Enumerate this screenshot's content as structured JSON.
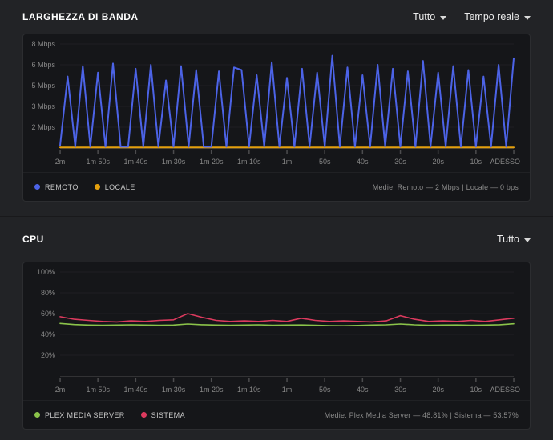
{
  "controls": {
    "bandwidth_filter": "Tutto",
    "bandwidth_range": "Tempo reale",
    "cpu_filter": "Tutto"
  },
  "chart_data": [
    {
      "type": "line",
      "title": "LARGHEZZA DI BANDA",
      "averages": "Medie: Remoto — 2 Mbps | Locale — 0 bps",
      "ylim": [
        0,
        8
      ],
      "y_ticks": [
        {
          "value": 1.6,
          "label": "2 Mbps"
        },
        {
          "value": 3.2,
          "label": "3 Mbps"
        },
        {
          "value": 4.8,
          "label": "5 Mbps"
        },
        {
          "value": 6.4,
          "label": "6 Mbps"
        },
        {
          "value": 8,
          "label": "8 Mbps"
        }
      ],
      "x_tick_labels": [
        "2m",
        "1m 50s",
        "1m 40s",
        "1m 30s",
        "1m 20s",
        "1m 10s",
        "1m",
        "50s",
        "40s",
        "30s",
        "20s",
        "10s",
        "ADESSO"
      ],
      "legend_position": "bottom-left",
      "grid": "faint-horizontal",
      "series": [
        {
          "name": "LOCALE",
          "color": "#e5a00d",
          "values": [
            0.05,
            0.05
          ]
        },
        {
          "name": "REMOTO",
          "color": "#4c63e7",
          "values": [
            0.2,
            5.5,
            0.1,
            6.3,
            0.1,
            5.8,
            0.1,
            6.5,
            0.1,
            0.1,
            6.1,
            0.1,
            6.4,
            0.1,
            5.2,
            0.1,
            6.3,
            0.1,
            6.0,
            0.1,
            0.1,
            5.9,
            0.1,
            6.2,
            6.0,
            0.1,
            5.6,
            0.1,
            6.6,
            0.1,
            5.4,
            0.1,
            6.1,
            0.1,
            5.8,
            0.1,
            7.1,
            0.1,
            6.2,
            0.1,
            5.6,
            0.1,
            6.4,
            0.1,
            6.1,
            0.1,
            5.9,
            0.1,
            6.7,
            0.1,
            5.8,
            0.1,
            6.3,
            0.1,
            6.0,
            0.1,
            5.5,
            0.1,
            6.4,
            0.1,
            6.9
          ]
        }
      ]
    },
    {
      "type": "line",
      "title": "CPU",
      "averages": "Medie: Plex Media Server — 48.81% | Sistema — 53.57%",
      "ylim": [
        0,
        100
      ],
      "y_ticks": [
        {
          "value": 20,
          "label": "20%"
        },
        {
          "value": 40,
          "label": "40%"
        },
        {
          "value": 60,
          "label": "60%"
        },
        {
          "value": 80,
          "label": "80%"
        },
        {
          "value": 100,
          "label": "100%"
        }
      ],
      "x_tick_labels": [
        "2m",
        "1m 50s",
        "1m 40s",
        "1m 30s",
        "1m 20s",
        "1m 10s",
        "1m",
        "50s",
        "40s",
        "30s",
        "20s",
        "10s",
        "ADESSO"
      ],
      "legend_position": "bottom-left",
      "grid": "faint-horizontal",
      "series": [
        {
          "name": "PLEX MEDIA SERVER",
          "color": "#8bc34a",
          "values": [
            50.5,
            49.5,
            49,
            48.8,
            49,
            49.2,
            49,
            48.8,
            49,
            50,
            49.3,
            49,
            48.8,
            49,
            49.2,
            48.8,
            49,
            49.1,
            48.8,
            48.5,
            48.3,
            48.6,
            49,
            49.2,
            50,
            49.2,
            48.8,
            49,
            49.1,
            48.8,
            49,
            49.3,
            50.2
          ]
        },
        {
          "name": "SISTEMA",
          "color": "#dc3a5e",
          "values": [
            57,
            54.5,
            53.5,
            52.5,
            52,
            53,
            52.5,
            53.5,
            54,
            60,
            56.5,
            53.5,
            52.5,
            53,
            52.5,
            53.5,
            52.5,
            55.5,
            53.5,
            52.5,
            53,
            52.5,
            52,
            53,
            58,
            54.5,
            52.5,
            53,
            52.5,
            53.5,
            52.5,
            54,
            55.5
          ]
        }
      ]
    }
  ]
}
